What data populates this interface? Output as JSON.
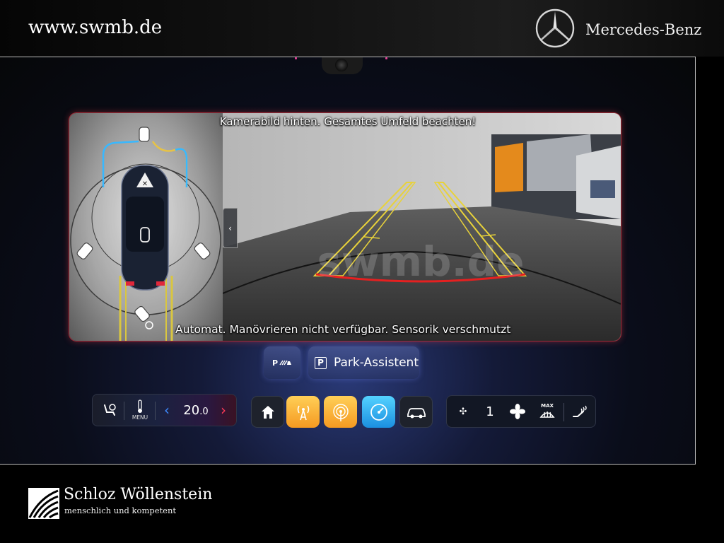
{
  "header": {
    "site_url": "www.swmb.de",
    "brand_name": "Mercedes-Benz"
  },
  "camera": {
    "top_caption": "Kamerabild hinten. Gesamtes Umfeld beachten!",
    "bottom_caption": "Automat. Manövrieren nicht verfügbar. Sensorik verschmutzt",
    "watermark": "swmb.de"
  },
  "parking": {
    "sensor_button_label": "P",
    "park_assist_label": "Park-Assistent",
    "park_assist_icon": "P"
  },
  "climate_left": {
    "seat_icon": "seat-climate-icon",
    "menu_label": "MENU",
    "temperature_main": "20",
    "temperature_decimal": ".0",
    "arrow_left": "‹",
    "arrow_right": "›"
  },
  "apps": [
    {
      "name": "home",
      "icon": "home-icon"
    },
    {
      "name": "radio",
      "icon": "radio-icon"
    },
    {
      "name": "radio-2",
      "icon": "radio-icon"
    },
    {
      "name": "gauge",
      "icon": "gauge-icon"
    },
    {
      "name": "vehicle",
      "icon": "car-icon"
    }
  ],
  "climate_right": {
    "fan_level": "1",
    "max_label": "MAX"
  },
  "footer": {
    "dealer_name": "Schloz Wöllenstein",
    "dealer_slogan": "menschlich und kompetent"
  },
  "colors": {
    "accent_blue": "#3d8bff",
    "accent_red": "#ff3a57",
    "guide_yellow": "#e8d23a",
    "guide_red": "#e02020",
    "app_orange": "#f5a623",
    "app_cyan": "#2aa8ee"
  }
}
